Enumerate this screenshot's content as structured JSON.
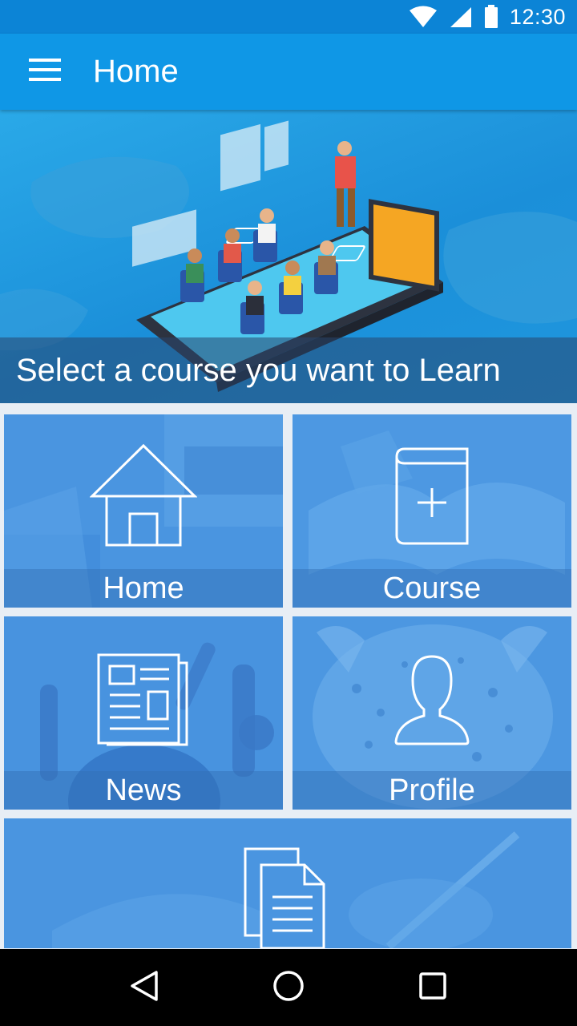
{
  "status_bar": {
    "time": "12:30",
    "icons": [
      "wifi-icon",
      "cell-signal-icon",
      "battery-icon"
    ]
  },
  "app_bar": {
    "title": "Home",
    "menu_icon": "hamburger-menu-icon"
  },
  "banner": {
    "caption": "Select a course you want to Learn"
  },
  "tiles": [
    {
      "label": "Home",
      "icon": "house-icon"
    },
    {
      "label": "Course",
      "icon": "book-add-icon"
    },
    {
      "label": "News",
      "icon": "newspaper-icon"
    },
    {
      "label": "Profile",
      "icon": "person-icon"
    },
    {
      "label": "",
      "icon": "documents-icon"
    }
  ],
  "nav_bar": {
    "icons": [
      "back-icon",
      "home-circle-icon",
      "recents-square-icon"
    ]
  },
  "colors": {
    "status_bar": "#0c84d6",
    "app_bar": "#0f97e6",
    "tile": "#4a95e0"
  }
}
